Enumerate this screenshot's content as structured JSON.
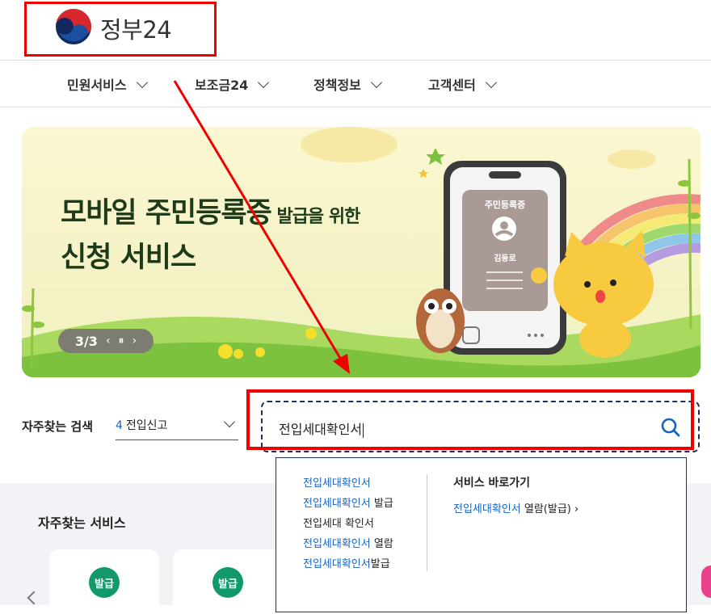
{
  "header": {
    "logo_text": "정부24"
  },
  "nav": {
    "items": [
      {
        "label": "민원서비스"
      },
      {
        "label": "보조금24"
      },
      {
        "label": "정책정보"
      },
      {
        "label": "고객센터"
      }
    ]
  },
  "banner": {
    "title_line1_big": "모바일 주민등록증",
    "title_line1_small": " 발급을 위한",
    "title_line2": "신청 서비스",
    "pager": "3/3",
    "card_title": "주민등록증",
    "card_name": "김동로"
  },
  "search": {
    "favorite_label": "자주찾는 검색",
    "favorite_rank": "4",
    "favorite_value": "전입신고",
    "query": "전입세대확인서"
  },
  "autocomplete": {
    "suggestions": [
      {
        "highlight": "전입세대확인서",
        "rest": ""
      },
      {
        "highlight": "전입세대확인서",
        "rest": " 발급"
      },
      {
        "highlight": "",
        "rest": "전입세대 확인서"
      },
      {
        "highlight": "전입세대확인서",
        "rest": " 열람"
      },
      {
        "highlight": "전입세대확인서",
        "rest": "발급"
      }
    ],
    "shortcut_title": "서비스 바로가기",
    "shortcut_highlight": "전입세대확인서",
    "shortcut_rest": " 열람(발급)",
    "shortcut_arrow": "›"
  },
  "services": {
    "title": "자주찾는 서비스",
    "cards": [
      {
        "badge": "발급"
      },
      {
        "badge": "발급"
      }
    ]
  },
  "colors": {
    "annotation": "#e00000",
    "accent_blue": "#1565c0",
    "badge_green": "#11996a"
  }
}
